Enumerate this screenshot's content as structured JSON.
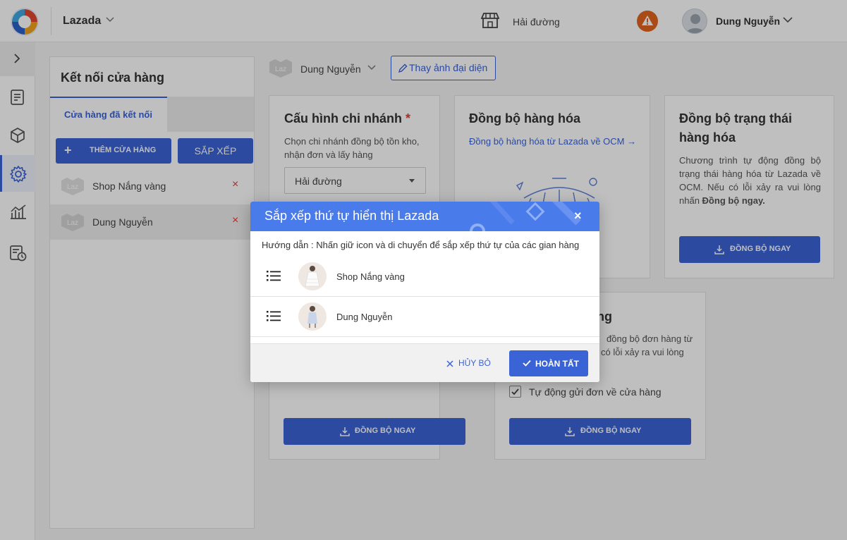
{
  "header": {
    "app_title": "Lazada",
    "branch": "Hải đường",
    "user_name": "Dung Nguyễn"
  },
  "store_panel": {
    "title": "Kết nối cửa hàng",
    "tab_connected": "Cửa hàng đã kết nối",
    "add_store_label": "THÊM CỬA HÀNG",
    "sort_label": "SẮP XẾP",
    "stores": [
      {
        "badge": "Laz",
        "name": "Shop Nắng vàng",
        "delete": "×"
      },
      {
        "badge": "Laz",
        "name": "Dung Nguyễn",
        "delete": "×"
      }
    ]
  },
  "profile": {
    "badge": "Laz",
    "name": "Dung Nguyễn",
    "change_avatar_label": "Thay ảnh đại diện"
  },
  "cards": {
    "branch_config": {
      "title": "Cấu hình chi nhánh",
      "required_mark": "*",
      "description": "Chọn chi nhánh đồng bộ tồn kho, nhận đơn và lấy hàng",
      "selected_branch": "Hải đường"
    },
    "product_sync": {
      "title": "Đồng bộ hàng hóa",
      "link": "Đồng bộ hàng hóa từ Lazada về OCM →"
    },
    "status_sync": {
      "title": "Đồng bộ trạng thái hàng hóa",
      "description": "Chương trình tự động đồng bộ trạng thái hàng hóa từ Lazada về OCM. Nếu có lỗi xảy ra vui lòng nhấn",
      "description_bold": "Đồng bộ ngay.",
      "button": "ĐỒNG BỘ NGAY"
    },
    "order_sync": {
      "title_fragment": "ng",
      "line1": "đồng bộ đơn hàng từ",
      "line2": "có lỗi xảy ra vui lòng",
      "checkbox_label": "Tự động gửi đơn về cửa hàng",
      "checkbox_checked": true,
      "button": "ĐỒNG BỘ NGAY"
    },
    "branch_button": "ĐỒNG BỘ NGAY"
  },
  "modal": {
    "title": "Sắp xếp thứ tự hiển thị Lazada",
    "close": "×",
    "hint": "Hướng dẫn : Nhấn giữ icon và di chuyển để sắp xếp thứ tự của các gian hàng",
    "items": [
      {
        "name": "Shop Nắng vàng"
      },
      {
        "name": "Dung Nguyễn"
      }
    ],
    "cancel_label": "HỦY BỎ",
    "done_label": "HOÀN TẤT"
  },
  "colors": {
    "primary": "#3a63d6",
    "modal_header": "#4a7bea",
    "warning": "#e2651f",
    "danger": "#e23a3a"
  },
  "icons": {
    "logo": "ocm-logo-icon",
    "store": "store-icon",
    "warning": "warning-icon",
    "drag": "drag-handle-icon"
  }
}
